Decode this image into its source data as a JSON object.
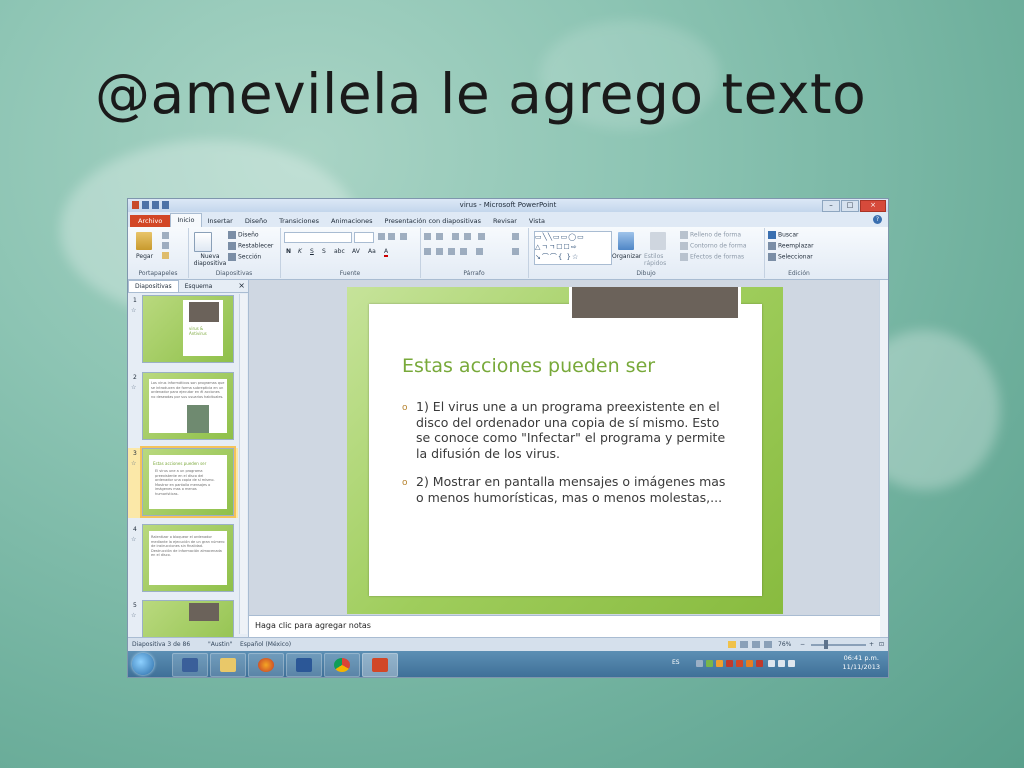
{
  "presentation_title": "@amevilela le agrego texto",
  "window": {
    "title": "virus - Microsoft PowerPoint"
  },
  "ribbon_tabs": [
    {
      "label": "Archivo"
    },
    {
      "label": "Inicio"
    },
    {
      "label": "Insertar"
    },
    {
      "label": "Diseño"
    },
    {
      "label": "Transiciones"
    },
    {
      "label": "Animaciones"
    },
    {
      "label": "Presentación con diapositivas"
    },
    {
      "label": "Revisar"
    },
    {
      "label": "Vista"
    }
  ],
  "ribbon": {
    "portapapeles": {
      "label": "Portapapeles",
      "paste": "Pegar"
    },
    "diapositivas": {
      "label": "Diapositivas",
      "new_slide": "Nueva diapositiva",
      "layout": "Diseño",
      "reset": "Restablecer",
      "section": "Sección"
    },
    "fuente": {
      "label": "Fuente"
    },
    "parrafo": {
      "label": "Párrafo"
    },
    "dibujo": {
      "label": "Dibujo",
      "arrange": "Organizar",
      "quick_styles": "Estilos rápidos",
      "fill": "Relleno de forma",
      "outline": "Contorno de forma",
      "effects": "Efectos de formas"
    },
    "edicion": {
      "label": "Edición",
      "find": "Buscar",
      "replace": "Reemplazar",
      "select": "Seleccionar"
    }
  },
  "left_pane": {
    "tabs": [
      "Diapositivas",
      "Esquema"
    ],
    "close": "×",
    "thumbnails": [
      {
        "num": "1",
        "text": "virus & Antivirus"
      },
      {
        "num": "2",
        "text": "Los virus informáticos son programas que se introducen de forma subrepticia en un ordenador para ejecutar en él acciones no deseadas por sus usuarios habituales."
      },
      {
        "num": "3",
        "title": "Estas acciones pueden ser",
        "text": "El virus une a un programa preexistente en el disco del ordenador una copia de sí mismo. Mostrar en pantalla mensajes o imágenes mas o menos humorísticas."
      },
      {
        "num": "4",
        "text": "Ralentizar o bloquear el ordenador mediante la ejecución de un gran número de instrucciones sin finalidad. Destrucción de información almacenada en el disco."
      },
      {
        "num": "5",
        "text": ""
      }
    ]
  },
  "slide": {
    "title": "Estas acciones pueden ser",
    "bullet_glyph": "o",
    "bullets": [
      "1) El virus une a un programa preexistente en el disco del ordenador una copia de sí mismo. Esto se conoce como \"Infectar\" el programa y permite la difusión de los virus.",
      "2) Mostrar en pantalla mensajes o imágenes mas o menos humorísticas, mas o menos molestas,..."
    ]
  },
  "notes_placeholder": "Haga clic para agregar notas",
  "status_bar": {
    "slide_info": "Diapositiva 3 de 86",
    "theme": "\"Austin\"",
    "language": "Español (México)",
    "zoom": "76%"
  },
  "taskbar": {
    "apps": [
      "media-player",
      "explorer",
      "firefox",
      "word",
      "chrome",
      "powerpoint"
    ],
    "language": "ES",
    "time": "06:41 p.m.",
    "date": "11/11/2013"
  },
  "colors": {
    "slide_green": "#9fcd5c",
    "title_green": "#78a93a",
    "file_tab": "#d24726",
    "taskbar": "#3f7098"
  }
}
